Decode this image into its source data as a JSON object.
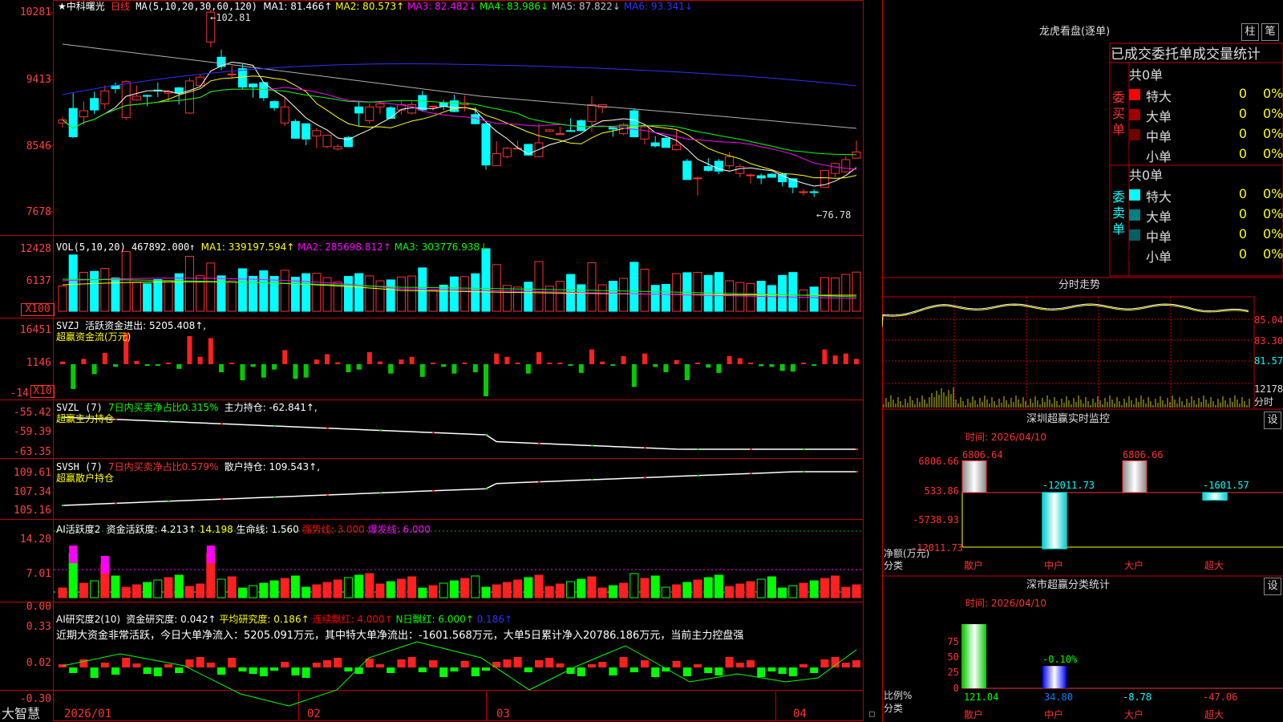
{
  "app": {
    "brand": "大智慧",
    "stock_name": "★中科曙光",
    "period": "日线"
  },
  "price_panel": {
    "ma_label": "MA(5,10,20,30,60,120)",
    "ma_values": [
      {
        "text": "MA1: 81.466↑",
        "color": "#ffffff"
      },
      {
        "text": "MA2: 80.573↑",
        "color": "#ffff00"
      },
      {
        "text": "MA3: 82.482↓",
        "color": "#ff00ff"
      },
      {
        "text": "MA4: 83.986↓",
        "color": "#00ff00"
      },
      {
        "text": "MA5: 87.822↓",
        "color": "#c0c0c0"
      },
      {
        "text": "MA6: 93.341↓",
        "color": "#3030ff"
      }
    ],
    "y_ticks": [
      "10281",
      "9413",
      "8546",
      "7678"
    ],
    "high_label": "102.81",
    "low_label": "76.78"
  },
  "vol_panel": {
    "title": "VOL(5,10,20)",
    "value": "467892.000↑",
    "ma_values": [
      {
        "text": "MA1: 339197.594↑",
        "color": "#ffff00"
      },
      {
        "text": "MA2: 285698.812↑",
        "color": "#ff00ff"
      },
      {
        "text": "MA3: 303776.938↓",
        "color": "#00ff00"
      }
    ],
    "y_ticks": [
      "12428",
      "6137"
    ],
    "unit": "X100"
  },
  "svzj_panel": {
    "title": "SVZJ",
    "label": "活跃资金进出: 5205.408↑,",
    "sub_title": "超赢资金流(万元)",
    "y_ticks": [
      "16451",
      "1146",
      "-14"
    ],
    "unit": "X10"
  },
  "svzl_panel": {
    "title": "SVZL (7)",
    "ratio": "7日内买卖净占比0.315%",
    "holding": "主力持仓: -62.841↑,",
    "sub_title": "超赢主力持仓",
    "y_ticks": [
      "-55.42",
      "-59.39",
      "-63.35"
    ]
  },
  "svsh_panel": {
    "title": "SVSH (7)",
    "ratio": "7日内买卖净占比0.579%",
    "holding": "散户持仓: 109.543↑,",
    "sub_title": "超赢散户持仓",
    "y_ticks": [
      "109.61",
      "107.34",
      "105.16"
    ]
  },
  "ai_active_panel": {
    "title": "AI活跃度2",
    "values": [
      {
        "text": "资金活跃度: 4.213↑",
        "color": "#ffffff"
      },
      {
        "text": "14.198",
        "color": "#ffff00"
      },
      {
        "text": "生命线: 1.560",
        "color": "#ffffff"
      },
      {
        "text": "强势线: 3.000",
        "color": "#ff0000"
      },
      {
        "text": "爆发线: 6.000",
        "color": "#ff00ff"
      }
    ],
    "y_ticks": [
      "14.20",
      "7.01",
      "0.00"
    ]
  },
  "ai_research_panel": {
    "title": "AI研究度2(10)",
    "values": [
      {
        "text": "资金研究度: 0.042↑",
        "color": "#ffffff"
      },
      {
        "text": "平均研究度: 0.186↑",
        "color": "#ffff00"
      },
      {
        "text": "连续飘红: 4.000↑",
        "color": "#ff0000"
      },
      {
        "text": "N日飘红: 6.000↑",
        "color": "#00ff00"
      },
      {
        "text": "0.186↑",
        "color": "#3030ff"
      }
    ],
    "summary": "近期大资金非常活跃，今日大单净流入：5205.091万元，其中特大单净流出：-1601.568万元，大单5日累计净入20786.186万元，当前主力控盘强",
    "y_ticks": [
      "0.33",
      "0.02",
      "-0.30"
    ]
  },
  "x_axis": {
    "labels": [
      "2026/01",
      "02",
      "03",
      "04"
    ]
  },
  "longhu": {
    "title": "龙虎看盘(逐单)",
    "btn_bar": "柱",
    "btn_pen": "笔",
    "subtitle": "已成交委托单成交量统计",
    "buy_title": "共0单",
    "buy_side": "委买单",
    "sell_title": "共0单",
    "sell_side": "委卖单",
    "buy_rows": [
      {
        "name": "特大",
        "v1": "0",
        "v2": "0%",
        "color": "#ff0000"
      },
      {
        "name": "大单",
        "v1": "0",
        "v2": "0%",
        "color": "#a00000"
      },
      {
        "name": "中单",
        "v1": "0",
        "v2": "0%",
        "color": "#700000"
      },
      {
        "name": "小单",
        "v1": "0",
        "v2": "0%",
        "color": "#000000"
      }
    ],
    "sell_rows": [
      {
        "name": "特大",
        "v1": "0",
        "v2": "0%",
        "color": "#00ffff"
      },
      {
        "name": "大单",
        "v1": "0",
        "v2": "0%",
        "color": "#008080"
      },
      {
        "name": "中单",
        "v1": "0",
        "v2": "0%",
        "color": "#006060"
      },
      {
        "name": "小单",
        "v1": "0",
        "v2": "0%",
        "color": "#000000"
      }
    ]
  },
  "intraday": {
    "title": "分时走势",
    "y_ticks": [
      "85.04",
      "83.30",
      "81.57"
    ],
    "vol_tick": "12178",
    "vol_unit": "分时"
  },
  "sz_monitor": {
    "title": "深圳超赢实时监控",
    "btn": "设",
    "time": "时间: 2026/04/10",
    "y_ticks": [
      "6806.66",
      "533.86",
      "-5738.93",
      "-12011.73"
    ],
    "y_label": "净额(万元)",
    "x_label": "分类",
    "categories": [
      "散户",
      "中户",
      "大户",
      "超大"
    ],
    "values": [
      6806.64,
      -12011.73,
      6806.66,
      -1601.57
    ],
    "value_labels": [
      "6806.64",
      "-12011.73",
      "6806.66",
      "-1601.57"
    ]
  },
  "sz_class": {
    "title": "深市超赢分类统计",
    "btn": "设",
    "time": "时间: 2026/04/10",
    "y_ticks": [
      "75",
      "50",
      "25",
      "0"
    ],
    "y_label": "比例%",
    "x_label": "分类",
    "categories": [
      "散户",
      "中户",
      "大户",
      "超大"
    ],
    "values": [
      121.04,
      34.8,
      -8.78,
      -47.06
    ],
    "value_labels": [
      "121.04",
      "34.80",
      "-8.78",
      "-47.06"
    ],
    "mid_label": "-0.10%"
  },
  "chart_data": {
    "type": "candlestick",
    "ylim": [
      7678,
      10281
    ],
    "candles": [
      [
        8840,
        8880,
        8780,
        8920
      ],
      [
        9030,
        8660,
        8640,
        9230
      ],
      [
        8920,
        9000,
        8820,
        9120
      ],
      [
        9160,
        9010,
        8960,
        9250
      ],
      [
        9090,
        9260,
        9020,
        9330
      ],
      [
        9330,
        9290,
        9230,
        9370
      ],
      [
        8910,
        9380,
        8880,
        9400
      ],
      [
        9140,
        9190,
        9130,
        9330
      ],
      [
        9200,
        9190,
        9060,
        9210
      ],
      [
        9270,
        9260,
        9180,
        9370
      ],
      [
        9230,
        9250,
        9120,
        9270
      ],
      [
        9300,
        9230,
        9080,
        9310
      ],
      [
        8970,
        9390,
        8960,
        9430
      ],
      [
        9330,
        9440,
        9320,
        9470
      ],
      [
        9900,
        10290,
        9830,
        10320
      ],
      [
        9700,
        9580,
        9530,
        9800
      ],
      [
        9480,
        9480,
        9420,
        9590
      ],
      [
        9550,
        9310,
        9280,
        9610
      ],
      [
        9350,
        9310,
        9170,
        9360
      ],
      [
        9370,
        9170,
        9130,
        9380
      ],
      [
        9120,
        9040,
        9000,
        9140
      ],
      [
        8840,
        9050,
        8800,
        9180
      ],
      [
        8860,
        8640,
        8640,
        8890
      ],
      [
        8830,
        8630,
        8550,
        8830
      ],
      [
        8670,
        8740,
        8510,
        8770
      ],
      [
        8530,
        8680,
        8510,
        8680
      ],
      [
        8500,
        8530,
        8480,
        8560
      ],
      [
        8650,
        8530,
        8530,
        8670
      ],
      [
        9050,
        8970,
        8800,
        9130
      ],
      [
        8870,
        9050,
        8830,
        9100
      ],
      [
        9050,
        9090,
        8960,
        9130
      ],
      [
        9040,
        8900,
        8900,
        9060
      ],
      [
        9010,
        9080,
        8950,
        9130
      ],
      [
        8970,
        9080,
        8950,
        9120
      ],
      [
        9200,
        9010,
        8990,
        9260
      ],
      [
        9050,
        9060,
        9000,
        9070
      ],
      [
        9100,
        9060,
        9010,
        9140
      ],
      [
        9130,
        8990,
        8980,
        9210
      ],
      [
        9080,
        9100,
        8990,
        9200
      ],
      [
        8950,
        8830,
        8820,
        9050
      ],
      [
        8830,
        8290,
        8230,
        8840
      ],
      [
        8280,
        8440,
        8280,
        8600
      ],
      [
        8400,
        8510,
        8380,
        8530
      ],
      [
        8510,
        8510,
        8510,
        8610
      ],
      [
        8560,
        8420,
        8410,
        8560
      ],
      [
        8400,
        8580,
        8390,
        8830
      ],
      [
        8730,
        8750,
        8720,
        8760
      ],
      [
        8690,
        8700,
        8700,
        8790
      ],
      [
        8740,
        8730,
        8730,
        8900
      ],
      [
        8870,
        8740,
        8730,
        8890
      ],
      [
        8860,
        9080,
        8720,
        9190
      ],
      [
        9040,
        9080,
        8970,
        9080
      ],
      [
        8780,
        8760,
        8660,
        8800
      ],
      [
        8700,
        8820,
        8680,
        8840
      ],
      [
        9000,
        8660,
        8650,
        9030
      ],
      [
        8630,
        8790,
        8560,
        8810
      ],
      [
        8580,
        8540,
        8520,
        8670
      ],
      [
        8640,
        8520,
        8520,
        8660
      ],
      [
        8490,
        8550,
        8480,
        8760
      ],
      [
        8340,
        8100,
        8100,
        8370
      ],
      [
        8110,
        8120,
        7890,
        8140
      ],
      [
        8270,
        8220,
        8200,
        8380
      ],
      [
        8340,
        8210,
        8170,
        8370
      ],
      [
        8280,
        8400,
        8240,
        8460
      ],
      [
        8180,
        8270,
        8130,
        8300
      ],
      [
        8160,
        8160,
        8050,
        8180
      ],
      [
        8150,
        8120,
        8040,
        8180
      ],
      [
        8170,
        8130,
        8130,
        8180
      ],
      [
        8170,
        8070,
        8010,
        8190
      ],
      [
        8110,
        8000,
        7920,
        8120
      ],
      [
        7940,
        7940,
        7890,
        7970
      ],
      [
        7940,
        7930,
        7870,
        7970
      ],
      [
        8000,
        8220,
        8000,
        8220
      ],
      [
        8180,
        8310,
        8130,
        8320
      ],
      [
        8200,
        8360,
        8190,
        8410
      ],
      [
        8380,
        8460,
        8380,
        8610
      ]
    ]
  }
}
